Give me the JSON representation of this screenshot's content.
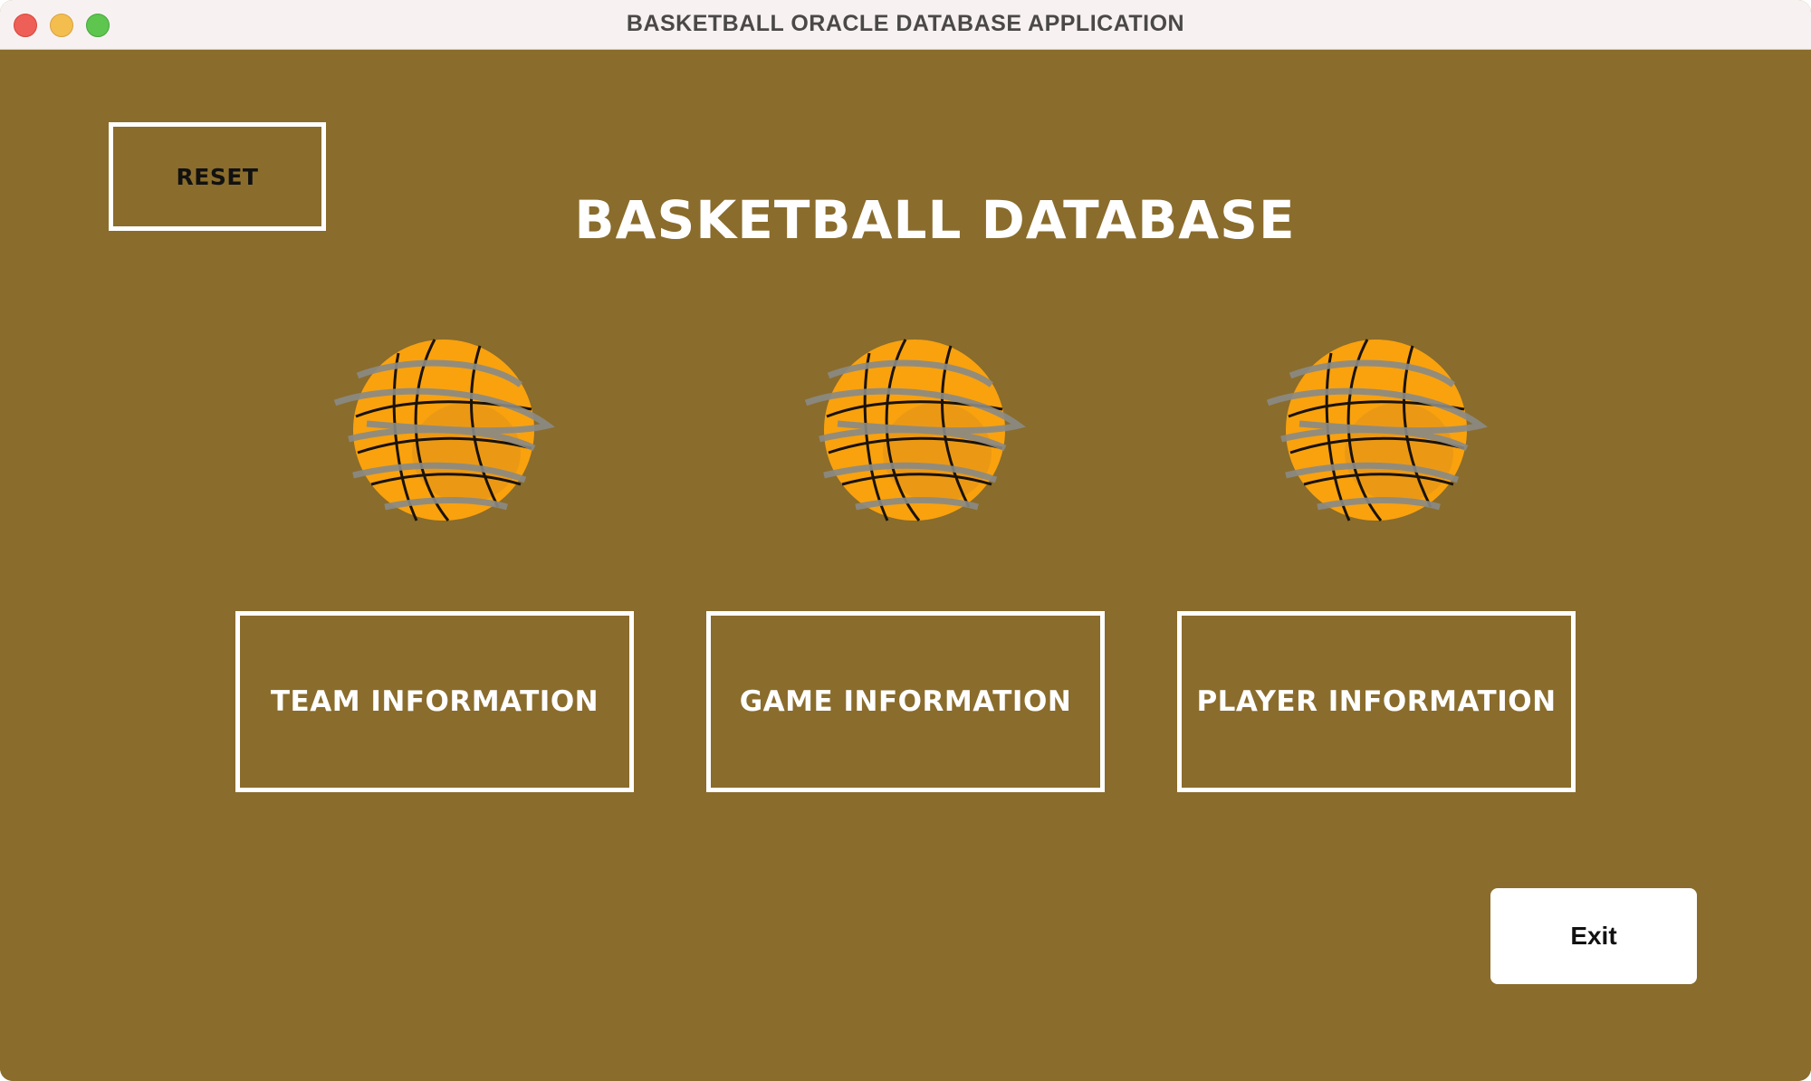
{
  "window": {
    "title": "BASKETBALL ORACLE DATABASE APPLICATION"
  },
  "toolbar": {
    "reset_label": "RESET"
  },
  "main": {
    "title": "BASKETBALL DATABASE",
    "sections": [
      {
        "label": "TEAM INFORMATION",
        "icon": "basketball-icon"
      },
      {
        "label": "GAME INFORMATION",
        "icon": "basketball-icon"
      },
      {
        "label": "PLAYER INFORMATION",
        "icon": "basketball-icon"
      }
    ]
  },
  "footer": {
    "exit_label": "Exit"
  },
  "colors": {
    "background": "#8a6c2c",
    "titlebar": "#f7f2f1",
    "ball": "#f9a20e",
    "button_border": "#ffffff"
  }
}
